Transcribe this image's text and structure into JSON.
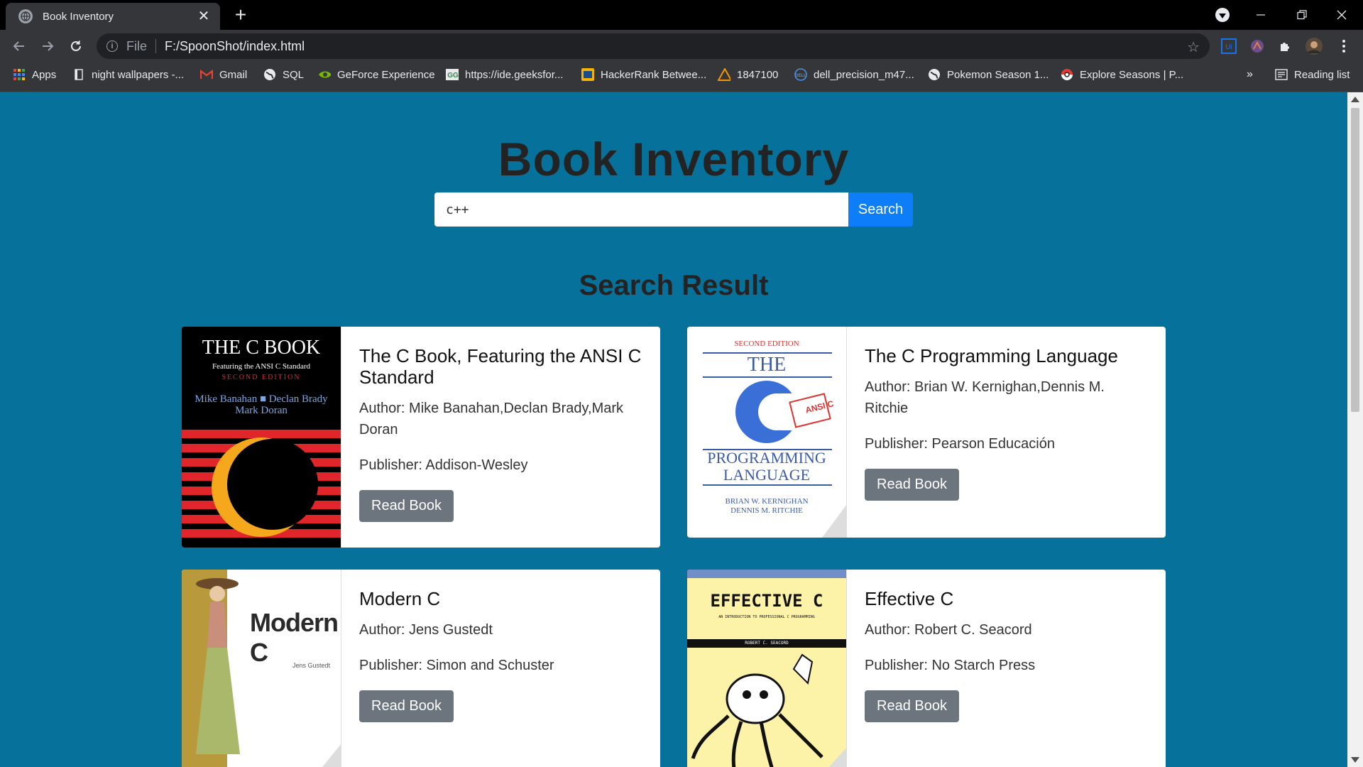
{
  "browser": {
    "tab_title": "Book Inventory",
    "tab_close": "✕",
    "new_tab": "+",
    "url_scheme": "File",
    "url": "F:/SpoonShot/index.html",
    "bookmarks": [
      {
        "label": "Apps",
        "icon": "apps-grid-icon"
      },
      {
        "label": "night wallpapers -...",
        "icon": "page-icon"
      },
      {
        "label": "Gmail",
        "icon": "gmail-icon"
      },
      {
        "label": "SQL",
        "icon": "globe-icon"
      },
      {
        "label": "GeForce Experience",
        "icon": "nvidia-icon"
      },
      {
        "label": "https://ide.geeksfor...",
        "icon": "geeksforgeeks-icon"
      },
      {
        "label": "HackerRank Betwee...",
        "icon": "hackerrank-icon"
      },
      {
        "label": "1847100",
        "icon": "triangle-icon"
      },
      {
        "label": "dell_precision_m47...",
        "icon": "dell-icon"
      },
      {
        "label": "Pokemon Season 1...",
        "icon": "globe-icon"
      },
      {
        "label": "Explore Seasons | P...",
        "icon": "pokeball-icon"
      }
    ],
    "bookmarks_overflow": "»",
    "reading_list": "Reading list"
  },
  "page": {
    "title": "Book Inventory",
    "search": {
      "value": "c++",
      "button": "Search"
    },
    "result_title": "Search Result"
  },
  "books": [
    {
      "title": "The C Book, Featuring the ANSI C Standard",
      "author": "Author: Mike Banahan,Declan Brady,Mark Doran",
      "publisher": "Publisher: Addison-Wesley",
      "button": "Read Book",
      "cover": {
        "line1": "THE C BOOK",
        "line2": "Featuring the ANSI C Standard",
        "line3": "SECOND EDITION",
        "line4": "Mike Banahan ■ Declan Brady",
        "line5": "Mark Doran"
      }
    },
    {
      "title": "The C Programming Language",
      "author": "Author: Brian W. Kernighan,Dennis M. Ritchie",
      "publisher": "Publisher: Pearson Educación",
      "button": "Read Book",
      "cover": {
        "line1": "SECOND EDITION",
        "line2": "THE",
        "line3": "C",
        "line4": "ANSI C",
        "line5": "PROGRAMMING LANGUAGE",
        "line6": "BRIAN W. KERNIGHAN",
        "line7": "DENNIS M. RITCHIE"
      }
    },
    {
      "title": "Modern C",
      "author": "Author: Jens Gustedt",
      "publisher": "Publisher: Simon and Schuster",
      "button": "Read Book",
      "cover": {
        "line1": "Modern C",
        "line2": "Jens Gustedt"
      }
    },
    {
      "title": "Effective C",
      "author": "Author: Robert C. Seacord",
      "publisher": "Publisher: No Starch Press",
      "button": "Read Book",
      "cover": {
        "line1": "EFFECTIVE C",
        "line2": "AN INTRODUCTION TO PROFESSIONAL C PROGRAMMING",
        "line3": "ROBERT C. SEACORD"
      }
    }
  ]
}
